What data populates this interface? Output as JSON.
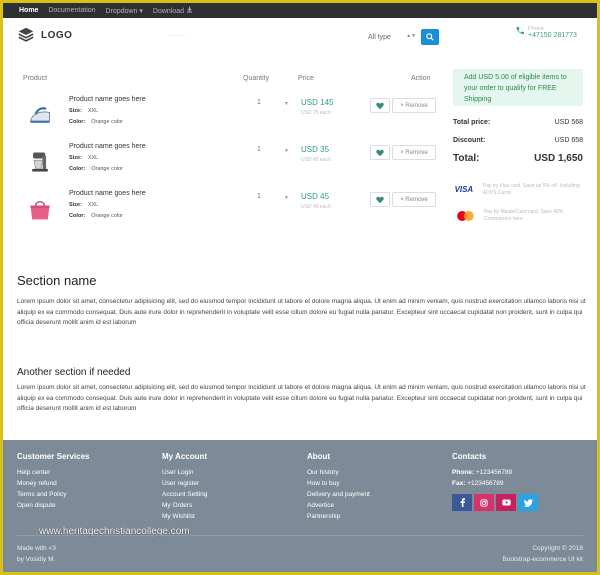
{
  "nav": {
    "items": [
      {
        "label": "Home",
        "active": true
      },
      {
        "label": "Documentation",
        "active": false
      },
      {
        "label": "Dropdown ▾",
        "active": false
      },
      {
        "label": "Download",
        "active": false
      }
    ]
  },
  "header": {
    "logo_text": "LOGO",
    "type_select": "All type",
    "phone_label": "Phone",
    "phone_number": "+47150 281773"
  },
  "cart": {
    "columns": {
      "product": "Product",
      "quantity": "Quantity",
      "price": "Price",
      "action": "Action"
    },
    "items": [
      {
        "name": "Product name goes here",
        "size_label": "Size:",
        "size": "XXL",
        "color_label": "Color:",
        "color": "Orange color",
        "qty": "1",
        "price": "USD 145",
        "each": "USD 75 each",
        "remove_label": "× Remove",
        "image_icon": "iron-icon"
      },
      {
        "name": "Product name goes here",
        "size_label": "Size:",
        "size": "XXL",
        "color_label": "Color:",
        "color": "Orange color",
        "qty": "1",
        "price": "USD 35",
        "each": "USD 45 each",
        "remove_label": "× Remove",
        "image_icon": "mixer-icon"
      },
      {
        "name": "Product name goes here",
        "size_label": "Size:",
        "size": "XXL",
        "color_label": "Color:",
        "color": "Orange color",
        "qty": "1",
        "price": "USD 45",
        "each": "USD 45 each",
        "remove_label": "× Remove",
        "image_icon": "handbag-icon"
      }
    ]
  },
  "summary": {
    "promo": "Add USD 5.00 of eligible items to your order to qualify for FREE Shipping",
    "total_price_label": "Total price:",
    "total_price": "USD 568",
    "discount_label": "Discount:",
    "discount": "USD 658",
    "total_label": "Total:",
    "total": "USD 1,650",
    "visa_text": "Pay by Visa card. Save up 5% off. Including ADVS Cards",
    "mastercard_text": "Pay by MasterCard card. Save 40% Commission here"
  },
  "section1": {
    "title": "Section name",
    "body": "Lorem ipsum dolor sit amet, consectetur adipisicing elit, sed do eiusmod tempor incididunt ut labore et dolore magna aliqua. Ut enim ad minim veniam, quis nostrud exercitation ullamco laboris nisi ut aliquip ex ea commodo consequat. Duis aute irure dolor in reprehenderit in voluptate velit esse cillum dolore eu fugiat nulla pariatur. Excepteur sint occaecat cupidatat non proident, sunt in culpa qui officia deserunt mollit anim id est laborum"
  },
  "section2": {
    "title": "Another section if needed",
    "body": "Lorem ipsum dolor sit amet, consectetur adipisicing elit, sed do eiusmod tempor incididunt ut labore et dolore magna aliqua. Ut enim ad minim veniam, quis nostrud exercitation ullamco laboris nisi ut aliquip ex ea commodo consequat. Duis aute irure dolor in reprehenderit in voluptate velit esse cillum dolore eu fugiat nulla pariatur. Excepteur sint occaecat cupidatat non proident, sunt in culpa qui officia deserunt mollit anim id est laborum"
  },
  "footer": {
    "customer_services": {
      "title": "Customer Services",
      "links": [
        "Help center",
        "Money refund",
        "Terms and Policy",
        "Open dispute"
      ]
    },
    "my_account": {
      "title": "My Account",
      "links": [
        "User Login",
        "User register",
        "Account Setting",
        "My Orders",
        "My Wishlist"
      ]
    },
    "about": {
      "title": "About",
      "links": [
        "Our history",
        "How to buy",
        "Delivery and payment",
        "Advertice",
        "Partnership"
      ]
    },
    "contacts": {
      "title": "Contacts",
      "phone_label": "Phone:",
      "phone": "+123456789",
      "fax_label": "Fax:",
      "fax": "+123456789"
    },
    "made_with": "Made with <3",
    "made_by": "by Vosidiy M.",
    "copyright": "Copyright © 2018",
    "brand": "Bootstrap-ecommerce UI kit",
    "watermark": "www.heritagechristiancollege.com"
  },
  "colors": {
    "accent": "#1a8ed6",
    "price_green": "#2a9d83",
    "footer_bg": "#7d8b98",
    "nav_bg": "#2d3135"
  }
}
